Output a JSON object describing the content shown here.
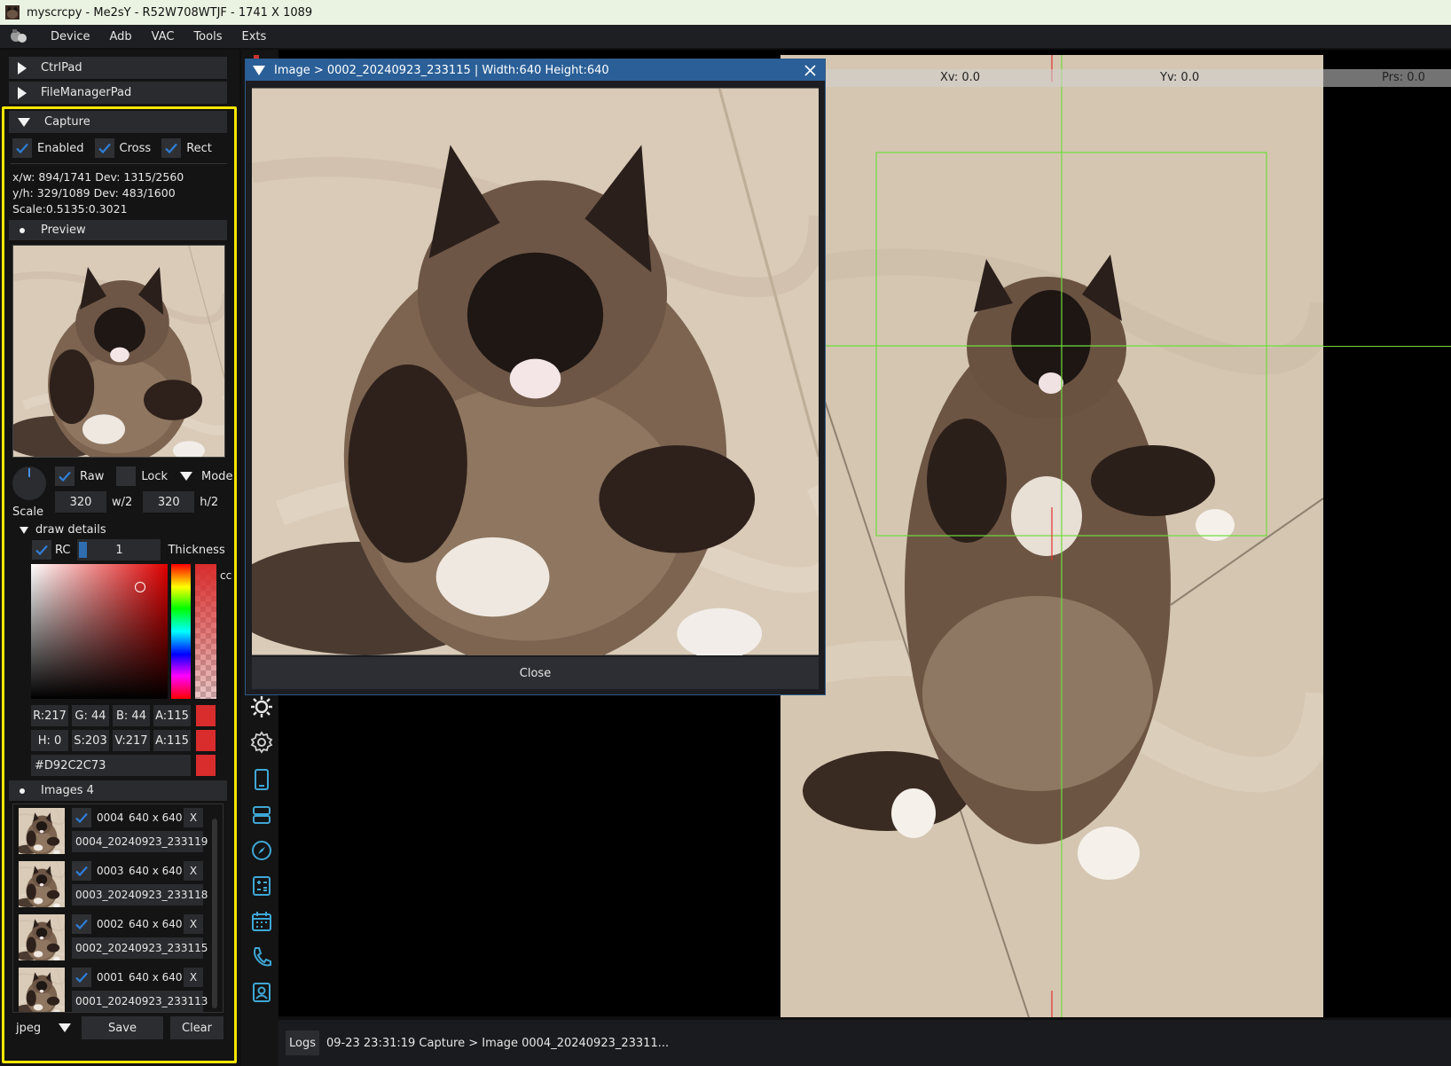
{
  "window": {
    "title": "myscrcpy - Me2sY - R52W708WTJF - 1741 X 1089"
  },
  "menu": [
    "Device",
    "Adb",
    "VAC",
    "Tools",
    "Exts"
  ],
  "panels": {
    "ctrlpad": "CtrlPad",
    "filemanagerpad": "FileManagerPad",
    "capture": "Capture"
  },
  "capture": {
    "enabled_label": "Enabled",
    "cross_label": "Cross",
    "rect_label": "Rect",
    "info_line1": "x/w: 894/1741 Dev: 1315/2560",
    "info_line2": "y/h: 329/1089 Dev:  483/1600",
    "info_line3": "Scale:0.5135:0.3021",
    "preview_label": "Preview",
    "scale_label": "Scale",
    "raw_label": "Raw",
    "lock_label": "Lock",
    "mode_label": "Mode",
    "width_value": "320",
    "w_suffix": "w/2",
    "height_value": "320",
    "h_suffix": "h/2"
  },
  "draw_details": {
    "label": "draw details",
    "rc_label": "RC",
    "thickness_value": "1",
    "thickness_label": "Thickness",
    "picker_cut_label": "cc",
    "rgba": [
      "R:217",
      "G: 44",
      "B: 44",
      "A:115"
    ],
    "hsva": [
      "H:  0",
      "S:203",
      "V:217",
      "A:115"
    ],
    "hex": "#D92C2C73",
    "color": "#d92c2c"
  },
  "images": {
    "header": "Images 4",
    "items": [
      {
        "id": "0004",
        "size": "640 x 640",
        "remove": "X",
        "name": "0004_20240923_233119"
      },
      {
        "id": "0003",
        "size": "640 x 640",
        "remove": "X",
        "name": "0003_20240923_233118"
      },
      {
        "id": "0002",
        "size": "640 x 640",
        "remove": "X",
        "name": "0002_20240923_233115"
      },
      {
        "id": "0001",
        "size": "640 x 640",
        "remove": "X",
        "name": "0001_20240923_233113"
      }
    ],
    "format": "jpeg",
    "save_label": "Save",
    "clear_label": "Clear"
  },
  "dialog": {
    "title": "Image > 0002_20240923_233115 | Width:640 Height:640",
    "close_icon": "x-icon",
    "close_label": "Close"
  },
  "screen": {
    "xv": "Xv: 0.0",
    "yv": "Yv: 0.0",
    "prs": "Prs: 0.0"
  },
  "logs": {
    "button_label": "Logs",
    "last_message": "09-23 23:31:19 Capture > Image 0004_20240923_23311..."
  },
  "toolbar_icons": [
    "sun-settings-icon",
    "gear-icon",
    "phone-icon",
    "server-icon",
    "compass-icon",
    "calculator-icon",
    "calendar-icon",
    "call-icon",
    "contact-icon"
  ],
  "accent": "#2b5f97",
  "highlight": "#f5e600"
}
